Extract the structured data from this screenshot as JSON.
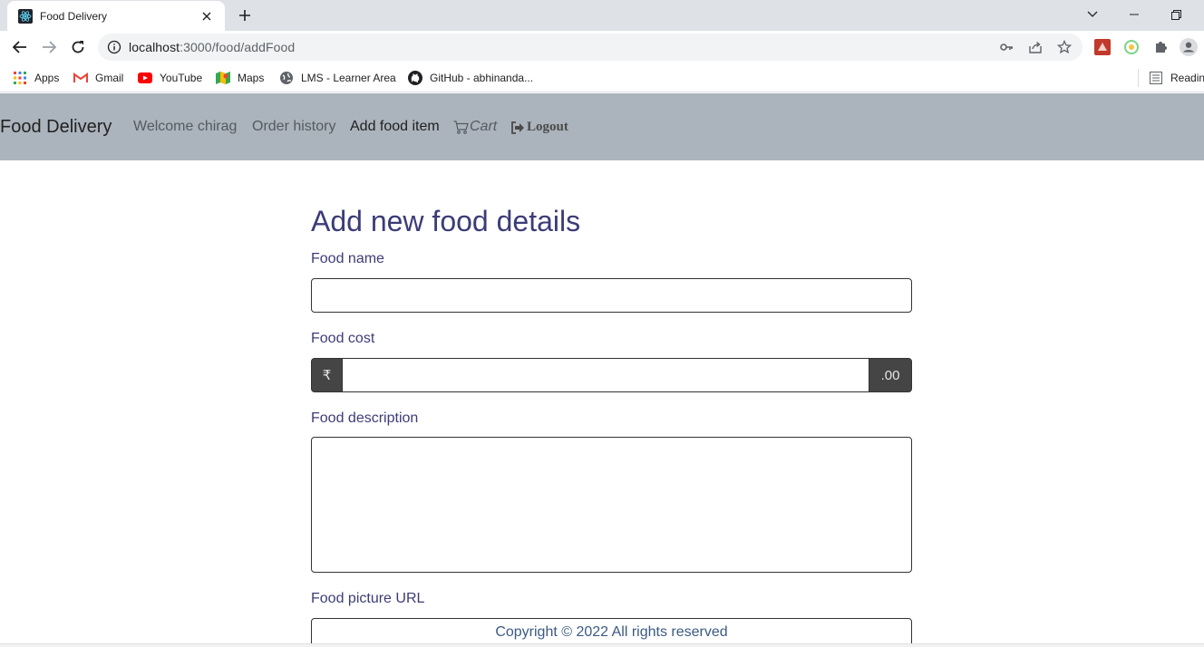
{
  "browser": {
    "tab_title": "Food Delivery",
    "url_host": "localhost",
    "url_path": ":3000/food/addFood",
    "bookmarks": [
      {
        "label": "Apps",
        "icon": "apps-grid-icon"
      },
      {
        "label": "Gmail",
        "icon": "gmail-icon"
      },
      {
        "label": "YouTube",
        "icon": "youtube-icon"
      },
      {
        "label": "Maps",
        "icon": "maps-icon"
      },
      {
        "label": "LMS - Learner Area",
        "icon": "globe-icon"
      },
      {
        "label": "GitHub - abhinanda...",
        "icon": "github-icon"
      }
    ],
    "reading_list": "Reading"
  },
  "navbar": {
    "brand": "Food Delivery",
    "links": {
      "welcome": "Welcome chirag",
      "orders": "Order history",
      "add_food": "Add food item",
      "cart": "Cart",
      "logout": "Logout"
    }
  },
  "form": {
    "title": "Add new food details",
    "name_label": "Food name",
    "cost_label": "Food cost",
    "currency_prefix": "₹",
    "cost_suffix": ".00",
    "description_label": "Food description",
    "picture_label": "Food picture URL"
  },
  "footer": {
    "text": "Copyright © 2022 All rights reserved"
  },
  "colors": {
    "navbar_bg": "#abb4bc",
    "form_text": "#3c3c78",
    "addon_bg": "#454545"
  }
}
